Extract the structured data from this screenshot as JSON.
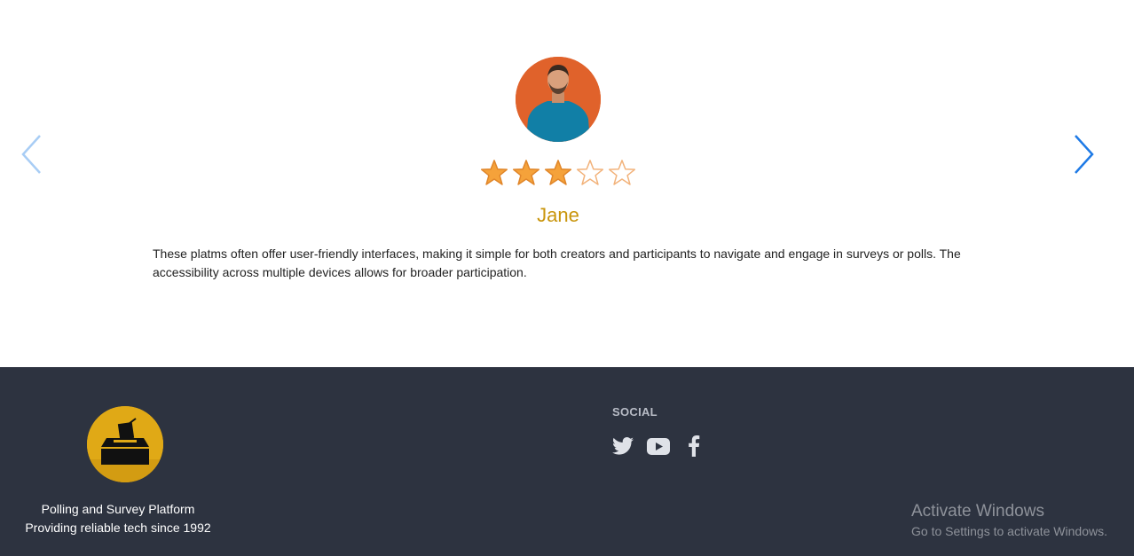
{
  "testimonial": {
    "name": "Jane",
    "rating": 3,
    "rating_max": 5,
    "quote": "These platms often offer user-friendly interfaces, making it simple for both creators and participants to navigate and engage in surveys or polls. The accessibility across multiple devices allows for broader participation.",
    "prev_icon": "chevron-left-icon",
    "next_icon": "chevron-right-icon"
  },
  "colors": {
    "name": "#c9950c",
    "star_fill": "#f5a23a",
    "footer_bg": "#2d3340",
    "logo_bg": "#e0a916",
    "nav_prev": "#a8cdf5",
    "nav_next": "#1e7ae6"
  },
  "footer": {
    "tagline_line1": "Polling and Survey Platform",
    "tagline_line2": "Providing reliable tech since 1992",
    "social_title": "SOCIAL",
    "social_icons": [
      "twitter-icon",
      "youtube-icon",
      "facebook-icon"
    ]
  },
  "watermark": {
    "title": "Activate Windows",
    "subtitle": "Go to Settings to activate Windows."
  }
}
